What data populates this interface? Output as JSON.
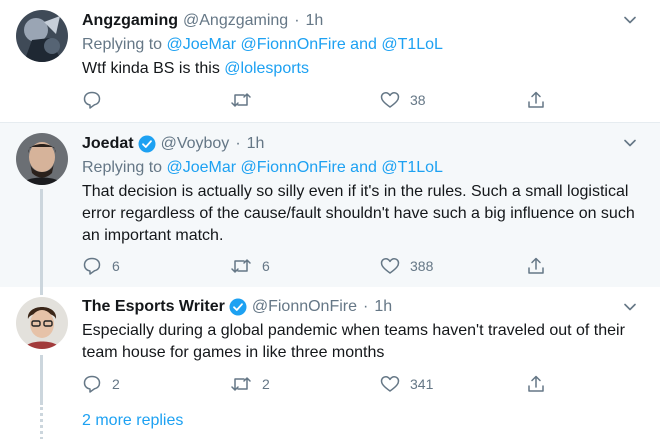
{
  "tweets": [
    {
      "name": "Angzgaming",
      "handle": "@Angzgaming",
      "sep": "·",
      "time": "1h",
      "replying_prefix": "Replying to",
      "replying_mentions": [
        "@JoeMar",
        "@FionnOnFire",
        "and",
        "@T1LoL"
      ],
      "text_plain": "Wtf kinda BS is this ",
      "text_mention": "@lolesports",
      "reply_count": "",
      "retweet_count": "",
      "like_count": "38"
    },
    {
      "name": "Joedat",
      "handle": "@Voyboy",
      "sep": "·",
      "time": "1h",
      "verified": true,
      "replying_prefix": "Replying to",
      "replying_mentions": [
        "@JoeMar",
        "@FionnOnFire",
        "and",
        "@T1LoL"
      ],
      "text": "That decision is actually so silly even if it's in the rules. Such a small logistical error regardless of the cause/fault shouldn't have such a big influence on such an important match.",
      "reply_count": "6",
      "retweet_count": "6",
      "like_count": "388"
    },
    {
      "name": "The Esports Writer",
      "handle": "@FionnOnFire",
      "sep": "·",
      "time": "1h",
      "verified": true,
      "text": "Especially during a global pandemic when teams haven't traveled out of their team house for games in like three months",
      "reply_count": "2",
      "retweet_count": "2",
      "like_count": "341"
    }
  ],
  "more_replies": "2 more replies",
  "colors": {
    "accent": "#1da1f2",
    "secondary": "#657786",
    "highlight_bg": "#f5f8fa"
  },
  "icons": [
    "chevron-down-icon",
    "reply-icon",
    "retweet-icon",
    "like-icon",
    "share-icon",
    "verified-icon"
  ]
}
